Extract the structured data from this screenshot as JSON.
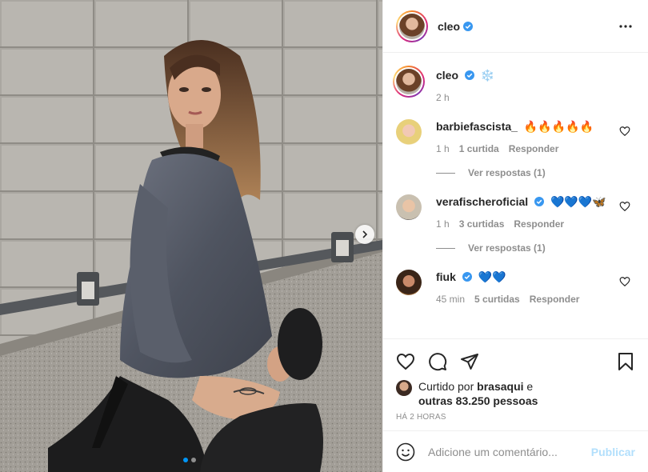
{
  "post": {
    "author": "cleo",
    "caption_suffix": "❄️",
    "caption_time": "2 h",
    "carousel": {
      "slides": 2,
      "active_index": 0
    }
  },
  "comments": [
    {
      "user": "barbiefascista_",
      "verified": false,
      "text": "🔥🔥🔥🔥🔥",
      "time": "1 h",
      "likes": "1 curtida",
      "reply": "Responder",
      "view_replies": "Ver respostas (1)"
    },
    {
      "user": "verafischeroficial",
      "verified": true,
      "text": "💙💙💙🦋",
      "time": "1 h",
      "likes": "3 curtidas",
      "reply": "Responder",
      "view_replies": "Ver respostas (1)"
    },
    {
      "user": "fiuk",
      "verified": true,
      "text": "💙💙",
      "time": "45 min",
      "likes": "5 curtidas",
      "reply": "Responder",
      "view_replies": ""
    }
  ],
  "likes": {
    "prefix": "Curtido por",
    "first_user": "brasaqui",
    "conjunction": "e",
    "others": "outras 83.250 pessoas"
  },
  "timestamp": "HÁ 2 HORAS",
  "comment_box": {
    "placeholder": "Adicione um comentário...",
    "publish_label": "Publicar"
  },
  "colors": {
    "verified": "#3897f0",
    "link_disabled": "#b2dffc",
    "secondary_text": "#8e8e8e",
    "carousel_active_dot": "#0095f6"
  },
  "icons": [
    "verified-badge-icon",
    "more-options-icon",
    "heart-icon",
    "comment-icon",
    "share-icon",
    "bookmark-icon",
    "emoji-icon",
    "chevron-right-icon"
  ]
}
